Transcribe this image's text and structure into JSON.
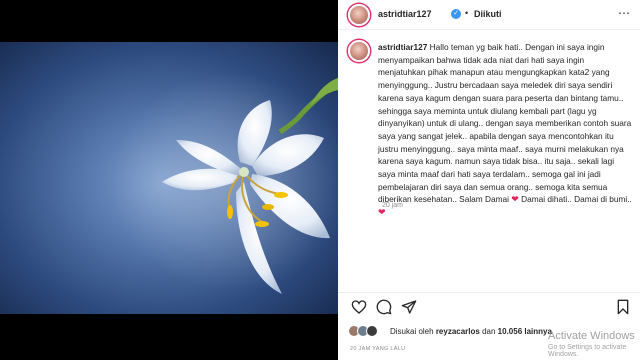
{
  "post": {
    "username": "astridtiar127",
    "follow_status": "Diikuti",
    "separator": "•",
    "more_icon": "⋯",
    "caption_text": "Hallo teman yg baik hati.. Dengan ini saya ingin menyampaikan bahwa tidak ada niat dari hati saya ingin menjatuhkan pihak manapun atau mengungkapkan kata2 yang menyinggung.. Justru bercadaan saya meledek diri saya sendiri karena saya kagum dengan suara para peserta dan bintang tamu.. sehingga saya meminta untuk diulang kembali part (lagu yg dinyanyikan) untuk di ulang.. dengan saya memberikan contoh suara saya yang sangat jelek.. apabila dengan saya mencontohkan itu justru menyinggung.. saya minta maaf.. saya murni melakukan nya karena saya kagum. namun saya tidak bisa.. itu saja.. sekali lagi saya minta maaf dari hati saya terdalam.. semoga gal ini jadi pembelajaran diri saya dan semua orang.. semoga kita semua diberikan kesehatan.. Salam Damai",
    "caption_tail": "Damai dihati.. Damai di bumi..",
    "heart_emoji": "❤",
    "time_ago": "20 jam",
    "liked_prefix": "Disukai oleh",
    "liked_user": "reyzacarlos",
    "liked_conj": "dan",
    "liked_count": "10.056 lainnya",
    "date": "20 JAM YANG LALU"
  },
  "icons": [
    "like-heart-icon",
    "comment-icon",
    "share-icon",
    "bookmark-icon",
    "verified-badge-icon",
    "more-options-icon"
  ],
  "colors": {
    "verified": "#3897f0",
    "heart": "#e0245e",
    "text": "#262626",
    "muted": "#8e8e8e"
  },
  "watermark": {
    "title": "Activate Windows",
    "subtitle": "Go to Settings to activate Windows."
  }
}
